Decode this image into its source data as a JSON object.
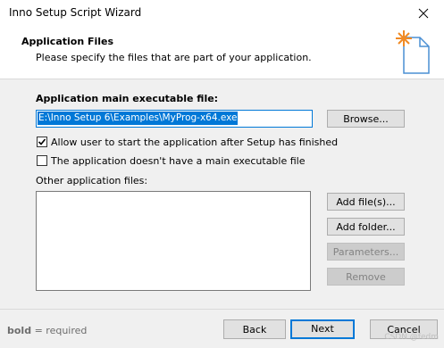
{
  "window": {
    "title": "Inno Setup Script Wizard"
  },
  "header": {
    "title": "Application Files",
    "subtitle": "Please specify the files that are part of your application."
  },
  "main": {
    "exe_label": "Application main executable file:",
    "exe_value": "E:\\Inno Setup 6\\Examples\\MyProg-x64.exe",
    "browse_label": "Browse...",
    "allow_user_label": "Allow user to start the application after Setup has finished",
    "allow_user_checked": true,
    "no_exe_label": "The application doesn't have a main executable file",
    "no_exe_checked": false,
    "other_files_label": "Other application files:",
    "add_files_label": "Add file(s)...",
    "add_folder_label": "Add folder...",
    "parameters_label": "Parameters...",
    "remove_label": "Remove"
  },
  "footer": {
    "note_bold": "bold",
    "note_rest": " = required",
    "back_label": "Back",
    "next_label": "Next",
    "cancel_label": "Cancel",
    "watermark": "CSDN @fedm"
  },
  "colors": {
    "accent": "#0078d7",
    "button_face": "#e1e1e1",
    "disabled_text": "#838383"
  }
}
